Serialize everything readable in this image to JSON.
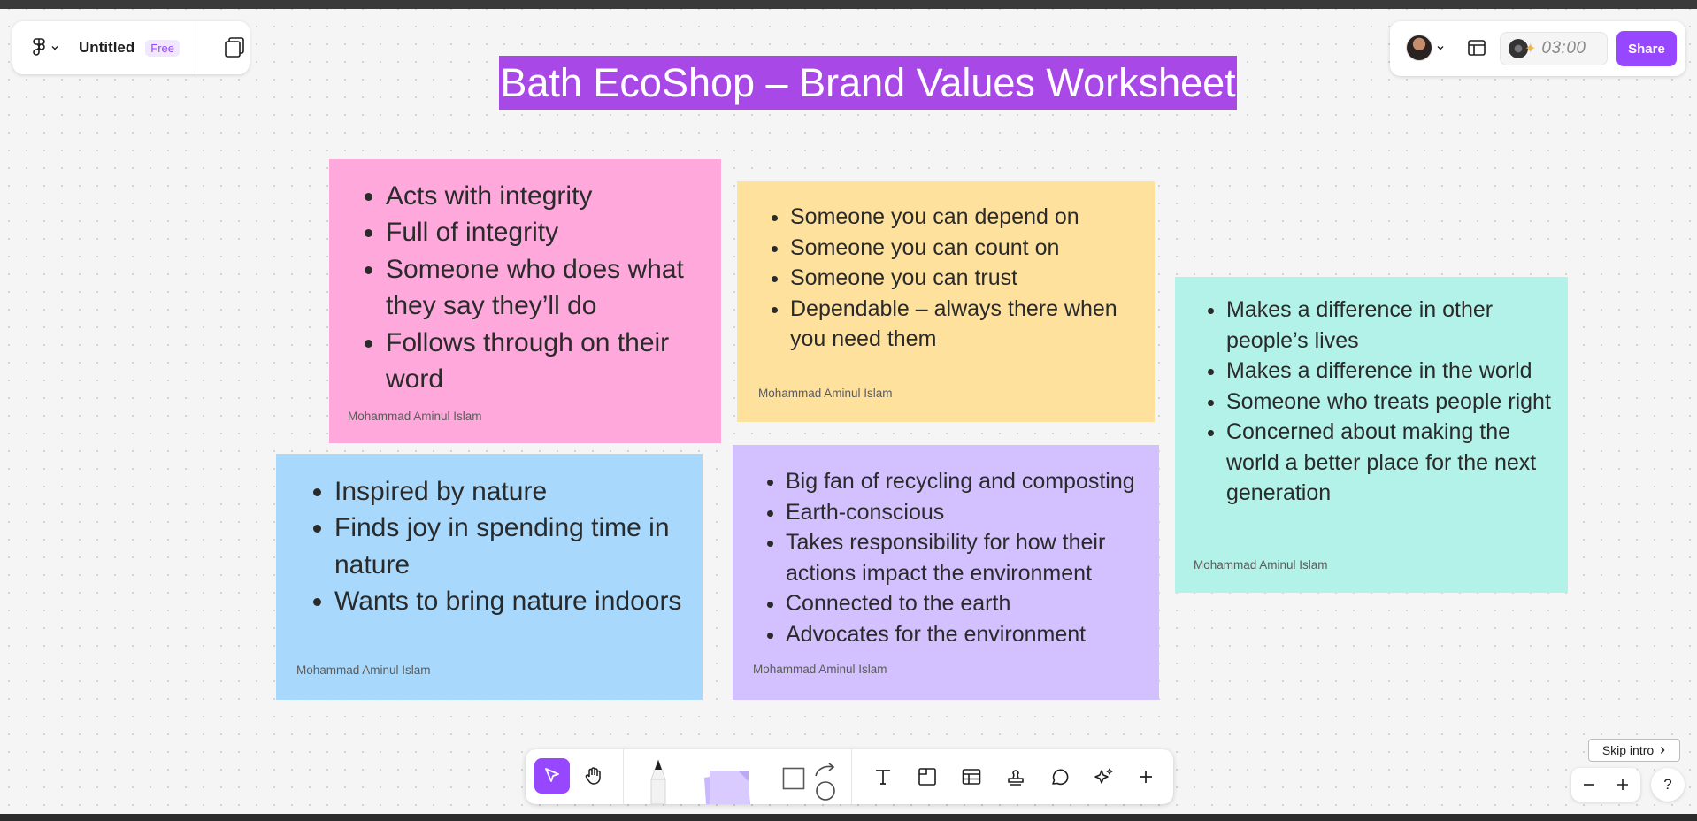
{
  "file": {
    "title": "Untitled",
    "plan_badge": "Free"
  },
  "header": {
    "timer": "03:00",
    "share_label": "Share"
  },
  "board": {
    "title": "Bath EcoShop – Brand Values Worksheet",
    "stickies": [
      {
        "color": "#ffa8db",
        "items": [
          "Acts with integrity",
          "Full of integrity",
          "Someone who does what they say they’ll do",
          "Follows through on their word"
        ],
        "author": "Mohammad Aminul Islam"
      },
      {
        "color": "#ffe19e",
        "items": [
          "Someone you can depend on",
          "Someone you can count on",
          "Someone you can trust",
          "Dependable – always there when you need them"
        ],
        "author": "Mohammad Aminul Islam"
      },
      {
        "color": "#b2f2e8",
        "items": [
          "Makes a difference in other people’s lives",
          "Makes a difference in the world",
          "Someone who treats people right",
          "Concerned about making the world a better place for the next generation"
        ],
        "author": "Mohammad Aminul Islam"
      },
      {
        "color": "#a8d9fd",
        "items": [
          "Inspired by nature",
          "Finds joy in spending time in nature",
          "Wants to bring nature indoors"
        ],
        "author": "Mohammad Aminul Islam"
      },
      {
        "color": "#d3c0ff",
        "items": [
          "Big fan of recycling and composting",
          "Earth-conscious",
          "Takes responsibility for how their actions impact the environment",
          "Connected to the earth",
          "Advocates for the environment"
        ],
        "author": "Mohammad Aminul Islam"
      }
    ]
  },
  "toolbar": {
    "tools": [
      "move-tool",
      "hand-tool",
      "pen-tool",
      "sticky-note-tool",
      "shape-tool",
      "connector-tool",
      "text-tool",
      "section-tool",
      "table-tool",
      "stamp-tool",
      "comment-tool",
      "ai-tool",
      "more-tools"
    ],
    "active_tool": "move-tool",
    "accent": "#9747ff"
  },
  "footer": {
    "skip_intro_label": "Skip intro",
    "help_label": "?"
  }
}
